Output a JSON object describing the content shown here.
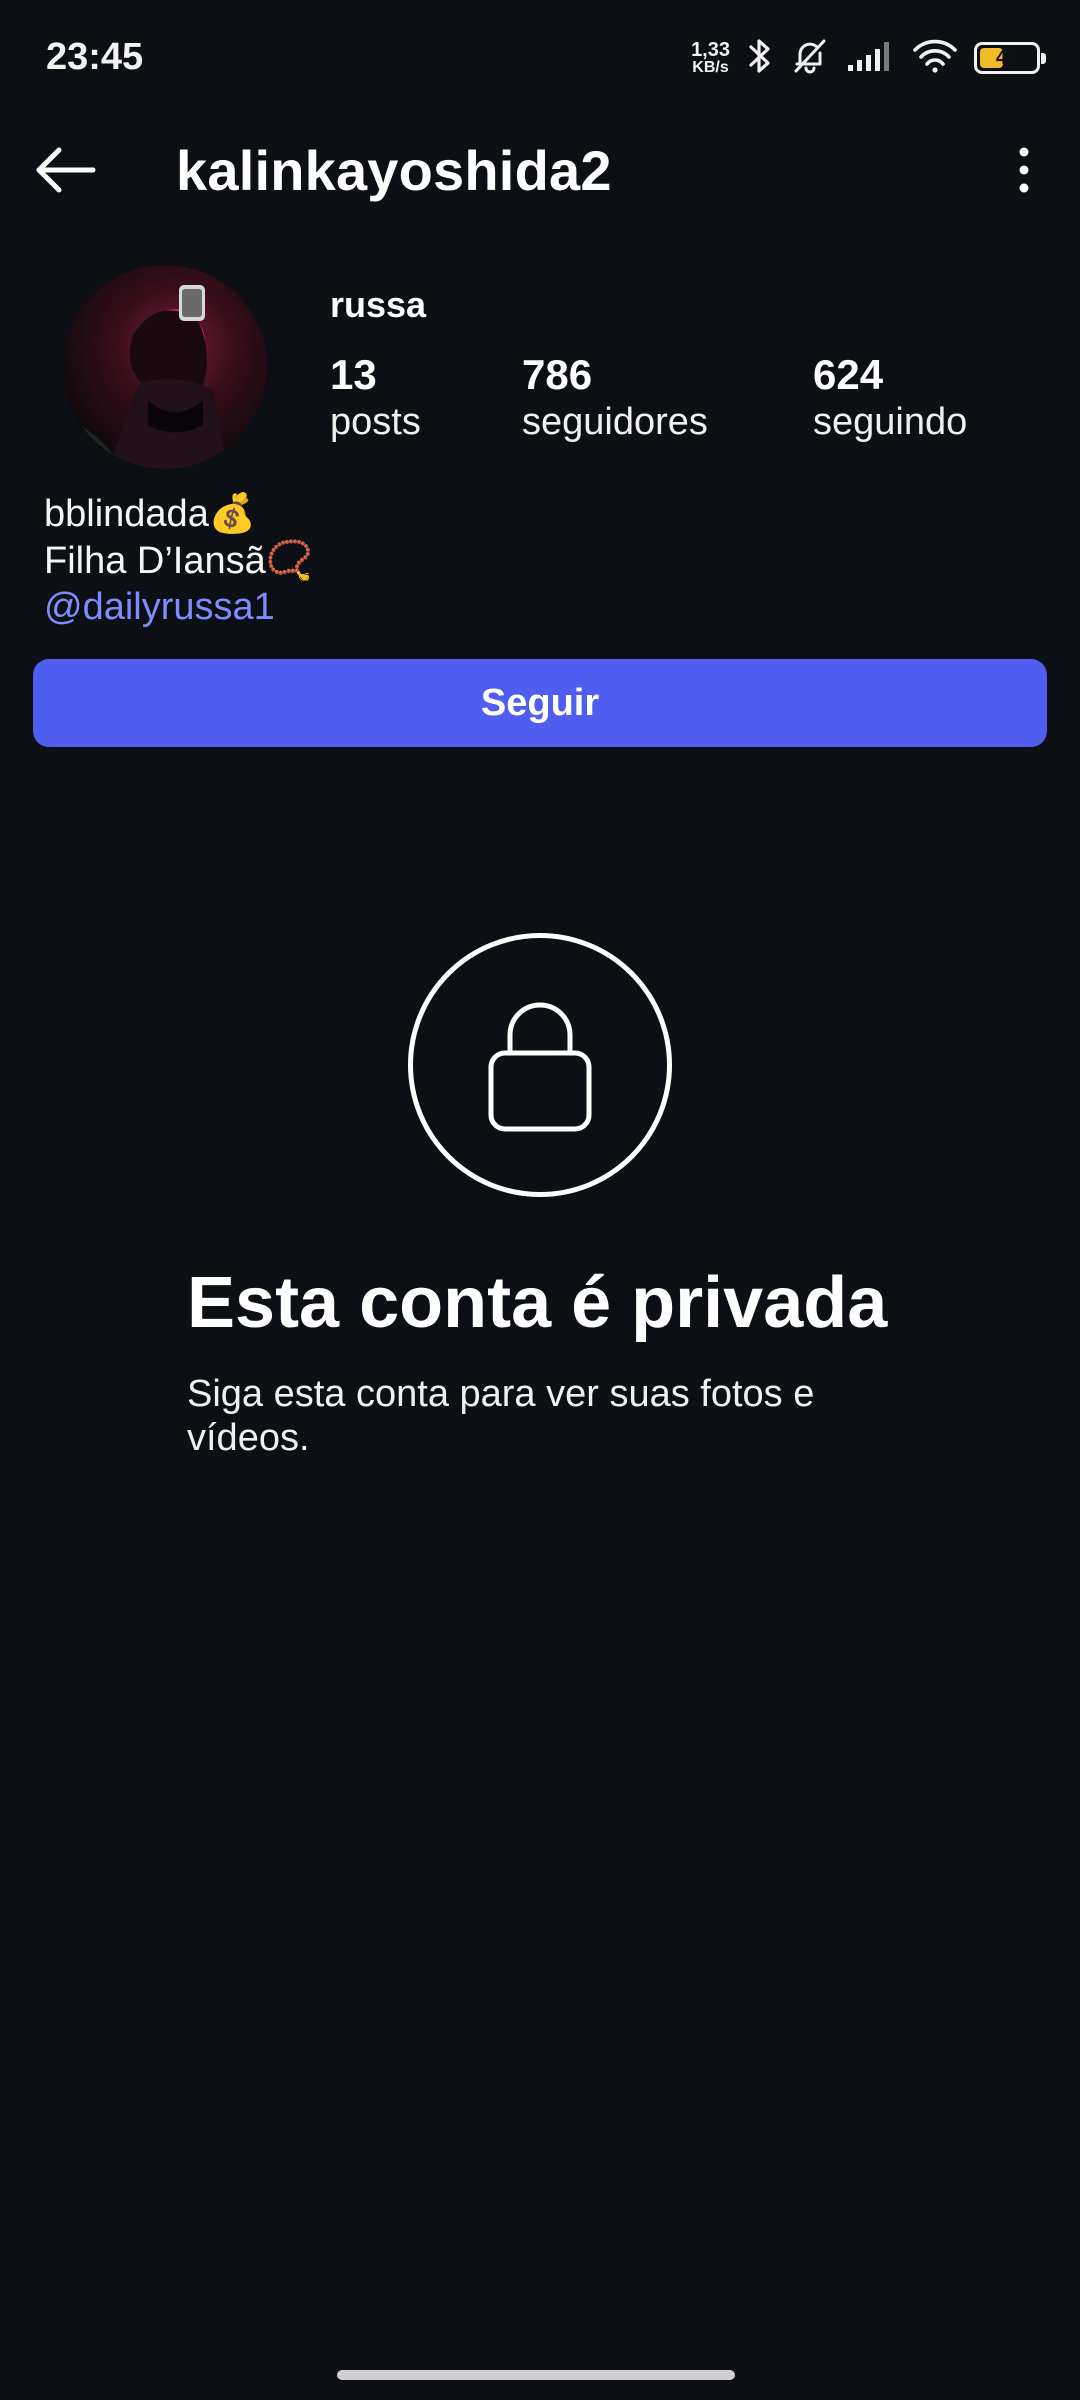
{
  "status_bar": {
    "time": "23:45",
    "net_speed_value": "1,33",
    "net_speed_unit": "KB/s",
    "battery_level": "48",
    "icons": [
      "bluetooth-icon",
      "bell-muted-icon",
      "signal-icon",
      "wifi-icon",
      "battery-icon"
    ]
  },
  "header": {
    "username": "kalinkayoshida2",
    "back_icon": "arrow-left-icon",
    "menu_icon": "more-vertical-icon"
  },
  "profile": {
    "display_name": "russa",
    "stats": {
      "posts": {
        "count": "13",
        "label": "posts"
      },
      "followers": {
        "count": "786",
        "label": "seguidores"
      },
      "following": {
        "count": "624",
        "label": "seguindo"
      }
    },
    "bio": {
      "line1_text": "bblindada",
      "line1_emoji": "💰",
      "line2_text": "Filha D’Iansã",
      "line2_emoji": "📿",
      "link": "@dailyrussa1"
    }
  },
  "actions": {
    "follow_label": "Seguir"
  },
  "private": {
    "icon": "lock-icon",
    "title": "Esta conta é privada",
    "description": "Siga esta conta para ver suas fotos e vídeos."
  },
  "colors": {
    "background": "#0c0f14",
    "accent": "#4f5ef0",
    "link": "#7f8cff",
    "battery": "#f2b928"
  }
}
